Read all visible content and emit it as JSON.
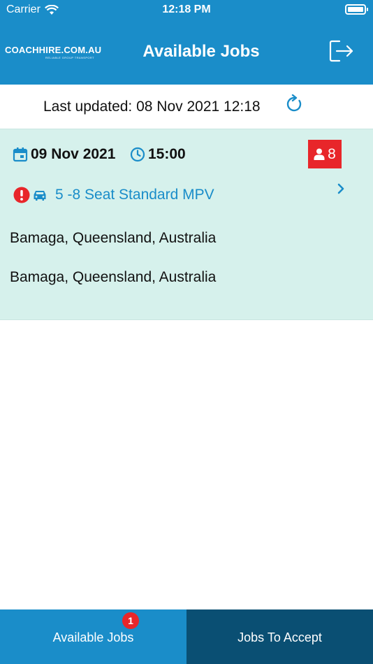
{
  "status": {
    "carrier": "Carrier",
    "time": "12:18 PM"
  },
  "header": {
    "logo_main": "COACHHIRE.COM.AU",
    "logo_sub": "RELIABLE GROUP TRANSPORT",
    "title": "Available Jobs"
  },
  "updated": {
    "text": "Last updated: 08 Nov 2021 12:18"
  },
  "job": {
    "date": "09 Nov 2021",
    "time": "15:00",
    "passengers": "8",
    "vehicle": "5 -8 Seat Standard MPV",
    "pickup": "Bamaga, Queensland, Australia",
    "dropoff": "Bamaga, Queensland, Australia"
  },
  "tabs": {
    "available_label": "Available Jobs",
    "available_badge": "1",
    "accept_label": "Jobs To Accept"
  },
  "colors": {
    "primary": "#1a8dc9",
    "dark_tab": "#0a4f73",
    "card_bg": "#d6f1ec",
    "alert": "#e8262a"
  }
}
